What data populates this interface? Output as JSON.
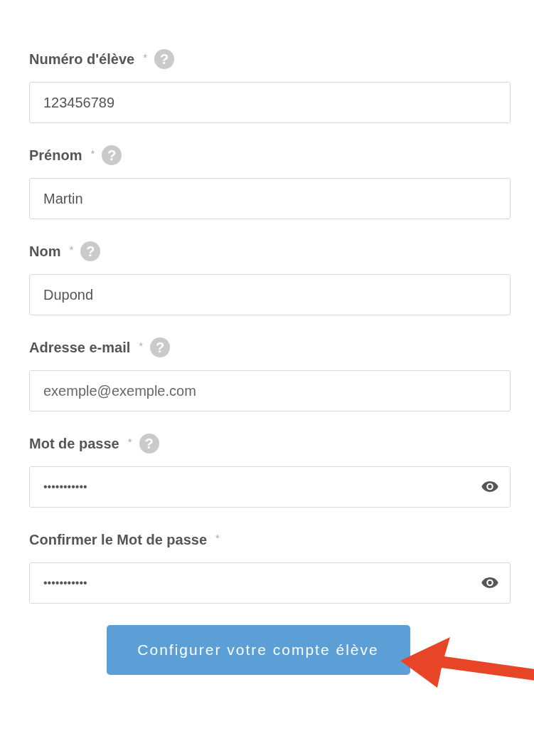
{
  "fields": [
    {
      "label": "Numéro d'élève",
      "required": "*",
      "help": "?",
      "kind": "text",
      "value": "123456789"
    },
    {
      "label": "Prénom",
      "required": "*",
      "help": "?",
      "kind": "text",
      "value": "Martin"
    },
    {
      "label": "Nom",
      "required": "*",
      "help": "?",
      "kind": "text",
      "value": "Dupond"
    },
    {
      "label": "Adresse e-mail",
      "required": "*",
      "help": "?",
      "kind": "text",
      "placeholder": "exemple@exemple.com"
    },
    {
      "label": "Mot de passe",
      "required": "*",
      "help": "?",
      "kind": "password",
      "value": "•••••••••••"
    },
    {
      "label": "Confirmer le Mot de passe",
      "required": "*",
      "kind": "password",
      "value": "•••••••••••"
    }
  ],
  "submit_button": "Configurer votre compte élève"
}
